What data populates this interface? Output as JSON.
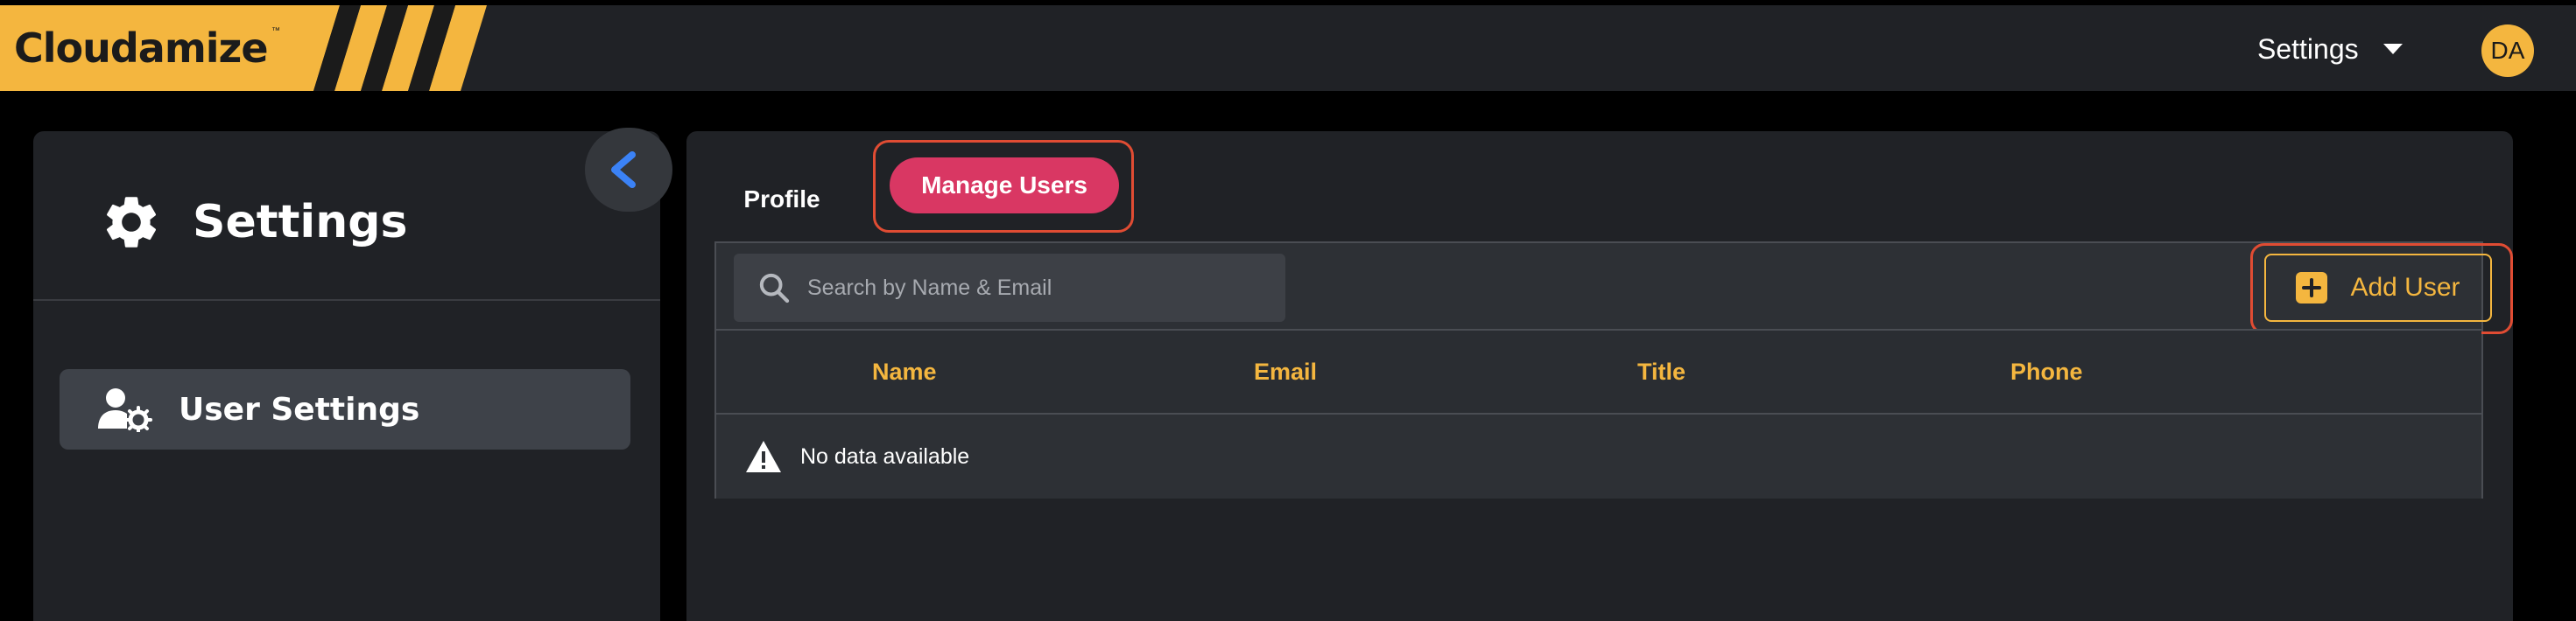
{
  "brand": {
    "name": "Cloudamize",
    "trademark": "™",
    "accent": "#f4b63f"
  },
  "header": {
    "settings_label": "Settings",
    "avatar_initials": "DA"
  },
  "sidebar": {
    "title": "Settings",
    "items": [
      {
        "label": "User Settings",
        "icon": "user-gear-icon"
      }
    ]
  },
  "tabs": [
    {
      "label": "Profile",
      "active": false
    },
    {
      "label": "Manage Users",
      "active": true
    }
  ],
  "search": {
    "placeholder": "Search by Name & Email",
    "value": ""
  },
  "add_user_label": "Add User",
  "table": {
    "columns": [
      "Name",
      "Email",
      "Title",
      "Phone"
    ],
    "empty_message": "No data available"
  },
  "colors": {
    "tab_active": "#d93763",
    "highlight_outline": "#e04c33",
    "collapse_chevron": "#3b82f6"
  }
}
